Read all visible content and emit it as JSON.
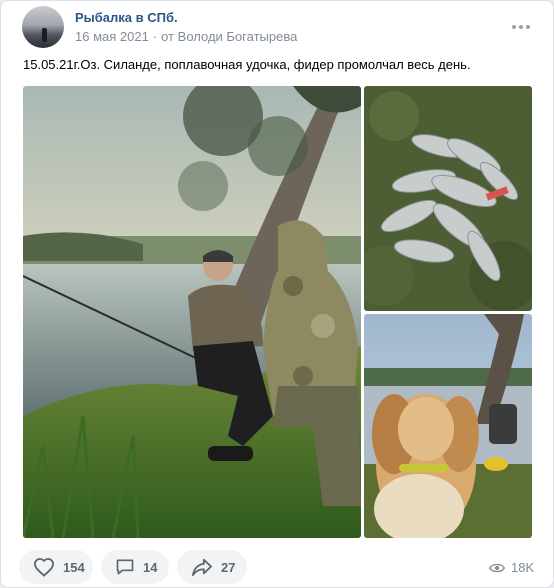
{
  "post": {
    "group_name": "Рыбалка в СПб.",
    "date": "16 мая 2021",
    "separator": "·",
    "author": "от Володи Богатырева",
    "text": "15.05.21г.Оз. Силанде, поплавочная удочка, фидер промолчал весь день.",
    "photos": [
      {
        "subject": "two fishermen sitting on the lake shore under pine trees"
      },
      {
        "subject": "pile of caught fish on grass"
      },
      {
        "subject": "spaniel dog by the lake"
      }
    ]
  },
  "actions": {
    "likes": "154",
    "comments": "14",
    "shares": "27",
    "views": "18K"
  },
  "icons": {
    "more": "more-icon",
    "like": "heart-icon",
    "comment": "comment-icon",
    "share": "share-icon",
    "views": "eye-icon"
  },
  "colors": {
    "accent": "#2a5885",
    "secondary_text": "#818c99",
    "pill_bg": "#f2f3f5"
  }
}
